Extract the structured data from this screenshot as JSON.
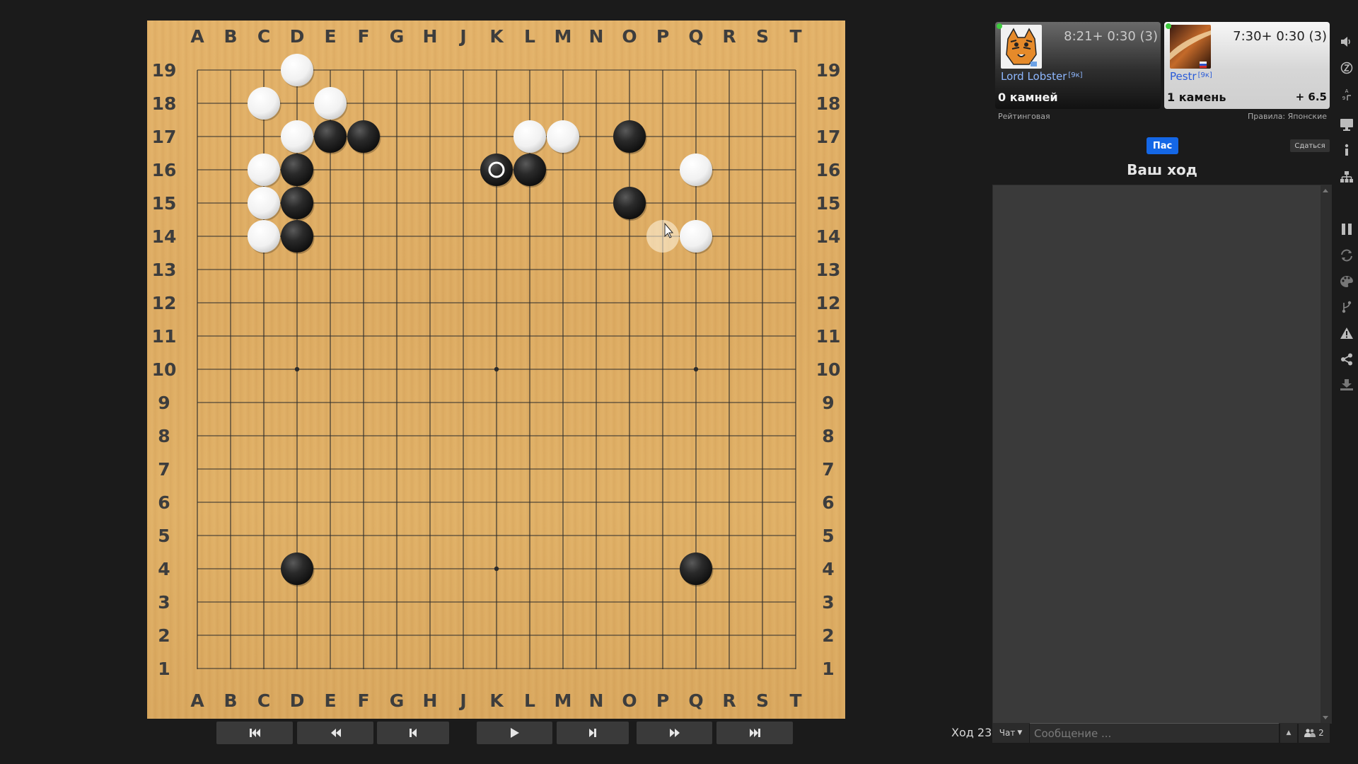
{
  "board": {
    "size": 19,
    "columns": [
      "A",
      "B",
      "C",
      "D",
      "E",
      "F",
      "G",
      "H",
      "J",
      "K",
      "L",
      "M",
      "N",
      "O",
      "P",
      "Q",
      "R",
      "S",
      "T"
    ],
    "rows": [
      "19",
      "18",
      "17",
      "16",
      "15",
      "14",
      "13",
      "12",
      "11",
      "10",
      "9",
      "8",
      "7",
      "6",
      "5",
      "4",
      "3",
      "2",
      "1"
    ],
    "star_points": [
      "D16",
      "K16",
      "Q16",
      "D10",
      "K10",
      "Q10",
      "D4",
      "K4",
      "Q4"
    ],
    "black_stones": [
      "E17",
      "F17",
      "D16",
      "D15",
      "D14",
      "L16",
      "K16",
      "O17",
      "O15",
      "D4",
      "Q4"
    ],
    "white_stones": [
      "D19",
      "C18",
      "E18",
      "D17",
      "C16",
      "C15",
      "C14",
      "L17",
      "M17",
      "Q16",
      "Q14"
    ],
    "last_move": "K16",
    "last_move_color": "black",
    "hover_point": "P14",
    "colors": {
      "board": "#dcaa62",
      "line": "#2b2b2b",
      "black": "#1f1f1f",
      "white": "#f4f4f4"
    }
  },
  "nav": {
    "buttons": [
      {
        "name": "first-move",
        "icon": "skip-to-start-icon"
      },
      {
        "name": "back-ten",
        "icon": "fast-backward-icon"
      },
      {
        "name": "previous-move",
        "icon": "step-backward-icon"
      },
      {
        "name": "play",
        "icon": "play-icon"
      },
      {
        "name": "next-move",
        "icon": "step-forward-icon"
      },
      {
        "name": "forward-ten",
        "icon": "fast-forward-icon"
      },
      {
        "name": "last-move",
        "icon": "skip-to-end-icon"
      }
    ]
  },
  "players": {
    "black": {
      "name": "Lord Lobster",
      "rank": "[9к]",
      "clock": "8:21+ 0:30  (3)",
      "captures": "0 камней"
    },
    "white": {
      "name": "Pestr",
      "rank": "[9к]",
      "clock": "7:30+ 0:30  (3)",
      "captures": "1 камень",
      "komi": "+ 6.5"
    }
  },
  "game": {
    "type_label": "Рейтинговая",
    "rules_label": "Правила: Японские",
    "pass_label": "Пас",
    "resign_label": "Сдаться",
    "status": "Ваш ход",
    "move_label": "Ход 23"
  },
  "chat": {
    "channel_label": "Чат",
    "input_placeholder": "Сообщение ...",
    "users_count": "2"
  },
  "sidebar_icons": [
    "volume-icon",
    "zen-mode-icon",
    "coordinates-icon",
    "presentation-icon",
    "info-icon",
    "tree-icon",
    "pause-icon",
    "refresh-icon",
    "palette-icon",
    "branch-icon",
    "warning-icon",
    "share-icon",
    "download-icon"
  ]
}
